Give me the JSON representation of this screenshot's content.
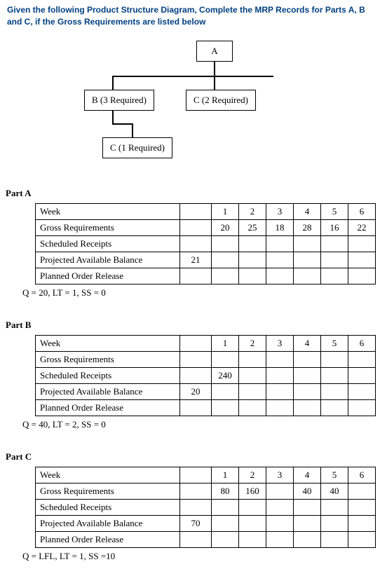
{
  "intro": "Given the following Product Structure Diagram, Complete the MRP Records for Parts A, B and C, if the Gross Requirements are listed below",
  "nodes": {
    "A": "A",
    "B": "B (3 Required)",
    "C2": "C (2 Required)",
    "C1": "C (1 Required)"
  },
  "common": {
    "rows": {
      "week": "Week",
      "gross": "Gross Requirements",
      "sched": "Scheduled Receipts",
      "pab": "Projected Available Balance",
      "por": "Planned Order Release"
    }
  },
  "partA": {
    "label": "Part A",
    "week": [
      "",
      "1",
      "2",
      "3",
      "4",
      "5",
      "6"
    ],
    "gross": [
      "",
      "20",
      "25",
      "18",
      "28",
      "16",
      "22"
    ],
    "sched": [
      "",
      "",
      "",
      "",
      "",
      "",
      ""
    ],
    "pab": [
      "21",
      "",
      "",
      "",
      "",
      "",
      ""
    ],
    "por": [
      "",
      "",
      "",
      "",
      "",
      "",
      ""
    ],
    "params": "Q = 20, LT = 1, SS = 0"
  },
  "partB": {
    "label": "Part B",
    "week": [
      "",
      "1",
      "2",
      "3",
      "4",
      "5",
      "6"
    ],
    "gross": [
      "",
      "",
      "",
      "",
      "",
      "",
      ""
    ],
    "sched": [
      "",
      "240",
      "",
      "",
      "",
      "",
      ""
    ],
    "pab": [
      "20",
      "",
      "",
      "",
      "",
      "",
      ""
    ],
    "por": [
      "",
      "",
      "",
      "",
      "",
      "",
      ""
    ],
    "params": "Q = 40, LT = 2, SS = 0"
  },
  "partC": {
    "label": "Part C",
    "week": [
      "",
      "1",
      "2",
      "3",
      "4",
      "5",
      "6"
    ],
    "gross": [
      "",
      "80",
      "160",
      "",
      "40",
      "40",
      ""
    ],
    "sched": [
      "",
      "",
      "",
      "",
      "",
      "",
      ""
    ],
    "pab": [
      "70",
      "",
      "",
      "",
      "",
      "",
      ""
    ],
    "por": [
      "",
      "",
      "",
      "",
      "",
      "",
      ""
    ],
    "params": "Q = LFL, LT = 1, SS =10"
  }
}
